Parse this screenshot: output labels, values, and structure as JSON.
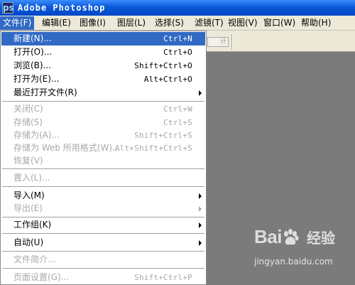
{
  "window": {
    "title": "Adobe Photoshop"
  },
  "menubar": [
    {
      "label": "文件(F)"
    },
    {
      "label": "编辑(E)"
    },
    {
      "label": "图像(I)"
    },
    {
      "label": "图层(L)"
    },
    {
      "label": "选择(S)"
    },
    {
      "label": "滤镜(T)"
    },
    {
      "label": "视图(V)"
    },
    {
      "label": "窗口(W)"
    },
    {
      "label": "帮助(H)"
    }
  ],
  "options_bar": {
    "button_label": "计"
  },
  "file_menu": {
    "items": [
      {
        "label": "新建(N)...",
        "shortcut": "Ctrl+N"
      },
      {
        "label": "打开(O)...",
        "shortcut": "Ctrl+O"
      },
      {
        "label": "浏览(B)...",
        "shortcut": "Shift+Ctrl+O"
      },
      {
        "label": "打开为(E)...",
        "shortcut": "Alt+Ctrl+O"
      },
      {
        "label": "最近打开文件(R)",
        "shortcut": ""
      },
      {
        "label": "关闭(C)",
        "shortcut": "Ctrl+W"
      },
      {
        "label": "存储(S)",
        "shortcut": "Ctrl+S"
      },
      {
        "label": "存储为(A)...",
        "shortcut": "Shift+Ctrl+S"
      },
      {
        "label": "存储为 Web 所用格式(W)...",
        "shortcut": "Alt+Shift+Ctrl+S"
      },
      {
        "label": "恢复(V)",
        "shortcut": ""
      },
      {
        "label": "置入(L)...",
        "shortcut": ""
      },
      {
        "label": "导入(M)",
        "shortcut": ""
      },
      {
        "label": "导出(E)",
        "shortcut": ""
      },
      {
        "label": "工作组(K)",
        "shortcut": ""
      },
      {
        "label": "自动(U)",
        "shortcut": ""
      },
      {
        "label": "文件简介...",
        "shortcut": ""
      },
      {
        "label": "页面设置(G)...",
        "shortcut": "Shift+Ctrl+P"
      }
    ]
  },
  "watermark": {
    "logo_left": "Bai",
    "logo_right": "经验",
    "url": "jingyan.baidu.com"
  },
  "colors": {
    "highlight": "#316ac5",
    "menu_bg": "#ece9d8",
    "workspace": "#7b7b7b",
    "disabled_text": "#a8a8a8"
  }
}
